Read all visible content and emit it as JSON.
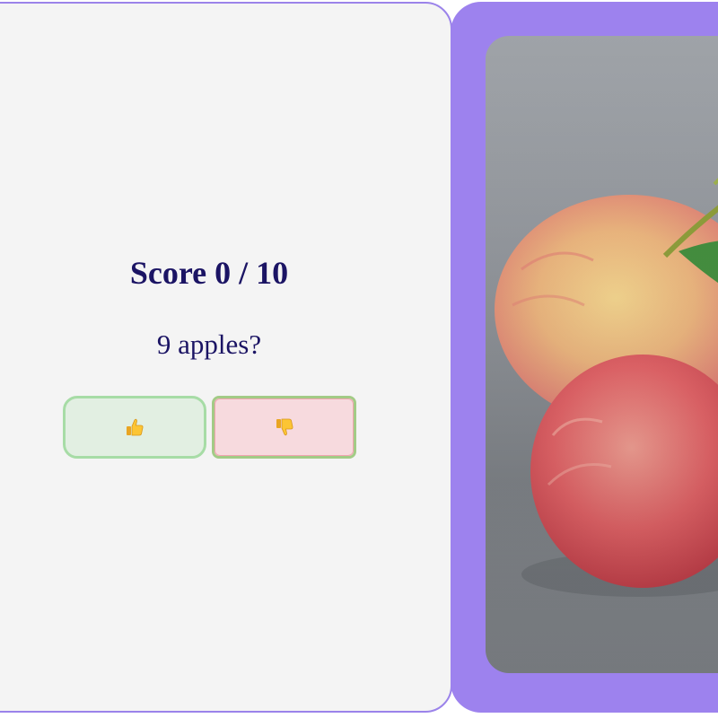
{
  "game": {
    "score_text": "Score 0 / 10",
    "question": "9 apples?",
    "yes_icon": "thumbs-up-icon",
    "no_icon": "thumbs-down-icon"
  },
  "colors": {
    "panel_accent": "#9d82ee",
    "text": "#1b1464",
    "yes_bg": "#e2efe2",
    "no_bg": "#f7dade"
  },
  "image": {
    "subject": "two red apples with stem and leaf on gray surface"
  }
}
